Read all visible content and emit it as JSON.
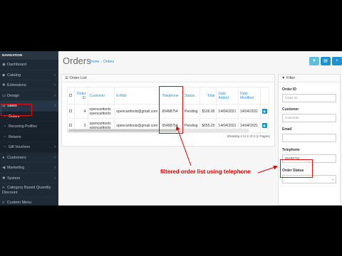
{
  "sidebar": {
    "header": "NAVIGATION",
    "items": [
      {
        "icon": "dashboard-icon",
        "glyph": "◉",
        "label": "Dashboard",
        "chevron": false
      },
      {
        "icon": "tag-icon",
        "glyph": "◆",
        "label": "Catalog",
        "chevron": true
      },
      {
        "icon": "puzzle-icon",
        "glyph": "✚",
        "label": "Extensions",
        "chevron": true
      },
      {
        "icon": "monitor-icon",
        "glyph": "▭",
        "label": "Design",
        "chevron": true
      },
      {
        "icon": "cart-icon",
        "glyph": "⊞",
        "label": "Sales",
        "chevron": true
      }
    ],
    "sales_sub": [
      "Orders",
      "Recurring Profiles",
      "Returns",
      "Gift Vouchers"
    ],
    "items_after": [
      {
        "icon": "user-icon",
        "glyph": "●",
        "label": "Customers",
        "chevron": true
      },
      {
        "icon": "share-icon",
        "glyph": "◀",
        "label": "Marketing",
        "chevron": true
      },
      {
        "icon": "cog-icon",
        "glyph": "✱",
        "label": "System",
        "chevron": true
      },
      {
        "icon": "list-icon",
        "glyph": "≡",
        "label": "Category Based Quantity Discount",
        "chevron": false
      },
      {
        "icon": "menu-icon",
        "glyph": "≡",
        "label": "Custom Menu",
        "chevron": false
      }
    ]
  },
  "page": {
    "title": "Orders",
    "breadcrumb": [
      "Home",
      "Orders"
    ]
  },
  "toolbar": {
    "filter_color": "#5bc0de",
    "print_color": "#1e91cf",
    "add_color": "#1e91cf"
  },
  "order_list": {
    "heading": "Order List",
    "columns": [
      "Order ID",
      "Customer",
      "E-Mail",
      "Telephone",
      "Status",
      "Total",
      "Date Added",
      "Date Modified"
    ],
    "rows": [
      {
        "order_id": "4",
        "customer": "opencarttools opencarttools",
        "email": "opencarttools@gmail.com",
        "telephone": "65498754",
        "status": "Pending",
        "total": "$106.00",
        "date_added": "14/04/2021",
        "date_modified": "14/04/2021"
      },
      {
        "order_id": "3",
        "customer": "opencarttools opencarttools",
        "email": "opencarttools@gmail.com",
        "telephone": "65498754",
        "status": "Pending",
        "total": "$655.20",
        "date_added": "14/04/2021",
        "date_modified": "14/04/2021"
      }
    ],
    "showing": "Showing 1 to 2 of 2 (1 Pages)"
  },
  "filter": {
    "heading": "Filter",
    "order_id_label": "Order ID",
    "order_id_placeholder": "Order ID",
    "customer_label": "Customer",
    "customer_placeholder": "Customer",
    "email_label": "Email",
    "email_value": "",
    "telephone_label": "Telephone",
    "telephone_value": "65498754",
    "status_label": "Order Status"
  },
  "annotation": {
    "text": "filtered order list using telephone",
    "color": "#e00000"
  }
}
